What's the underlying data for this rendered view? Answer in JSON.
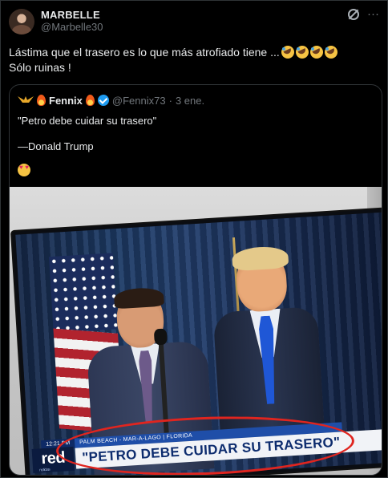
{
  "post": {
    "author_name": "MARBELLE",
    "author_handle": "@Marbelle30",
    "text_line1": "Lástima que el trasero es lo que más atrofiado tiene ...",
    "text_line2": "Sólo ruinas !",
    "grok_icon": "grok-icon",
    "more_label": "···"
  },
  "quote": {
    "name": "Fennix",
    "handle": "@Fennix73",
    "dot": "·",
    "date": "3 ene.",
    "quote_text": "\"Petro debe cuidar su trasero\"",
    "attribution": "—Donald Trump",
    "emoji": "heart-eyes"
  },
  "tv": {
    "time": "12:21 PM",
    "topline": "PALM BEACH - MAR-A-LAGO | FLORIDA",
    "headline": "\"PETRO DEBE CUIDAR SU TRASERO\"",
    "logo": "red",
    "logo_sub": "noticias"
  },
  "colors": {
    "accent_blue": "#1d9bf0",
    "highlight_circle": "#e0251f"
  }
}
